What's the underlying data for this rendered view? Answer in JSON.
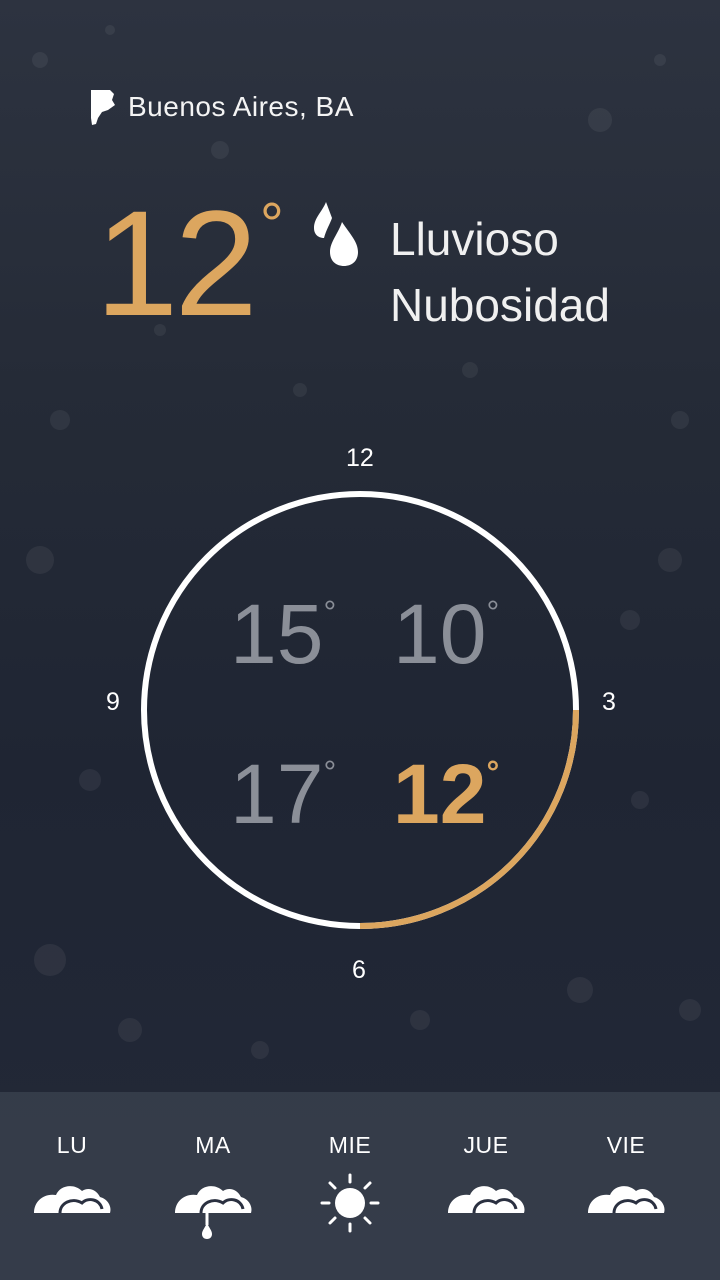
{
  "location": {
    "city": "Buenos Aires, BA",
    "icon": "buenos-aires-province-icon"
  },
  "current": {
    "temperature": "12",
    "degree_symbol": "°",
    "condition_icon": "raindrop-icon",
    "condition_line1": "Lluvioso",
    "condition_line2": "Nubosidad"
  },
  "clock": {
    "labels": {
      "top": "12",
      "right": "3",
      "bottom": "6",
      "left": "9"
    },
    "quadrant_temps": [
      {
        "position": "top-left",
        "value": "15",
        "active": false
      },
      {
        "position": "top-right",
        "value": "10",
        "active": false
      },
      {
        "position": "bottom-left",
        "value": "17",
        "active": false
      },
      {
        "position": "bottom-right",
        "value": "12",
        "active": true
      }
    ],
    "degree_symbol": "°",
    "highlight_fraction": 0.25
  },
  "forecast": [
    {
      "day": "LU",
      "icon": "cloud-icon"
    },
    {
      "day": "MA",
      "icon": "rain-cloud-icon"
    },
    {
      "day": "MIE",
      "icon": "sun-icon"
    },
    {
      "day": "JUE",
      "icon": "cloud-icon"
    },
    {
      "day": "VIE",
      "icon": "cloud-icon"
    }
  ],
  "colors": {
    "accent": "#dca65f",
    "ring": "#ffffff",
    "muted": "#8b8f98",
    "background": "#252b37"
  }
}
